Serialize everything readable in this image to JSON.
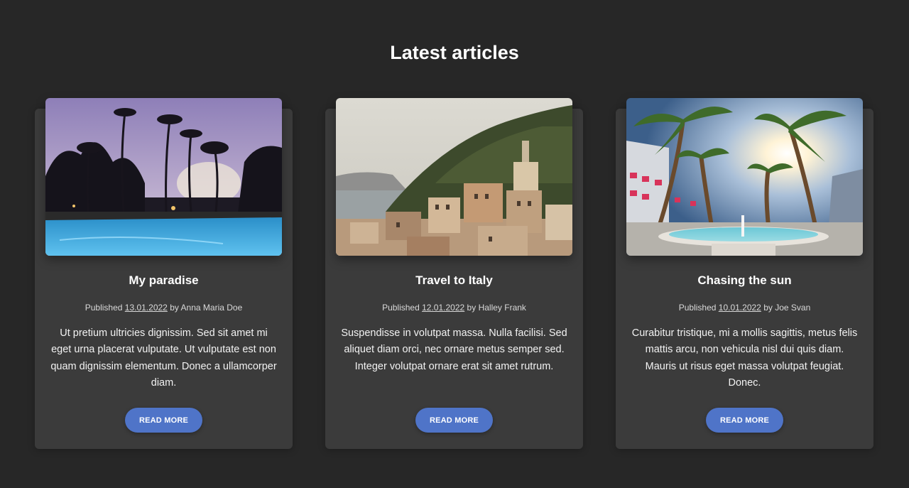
{
  "section": {
    "title": "Latest articles"
  },
  "articles": [
    {
      "title": "My paradise",
      "published_label": "Published",
      "date": "13.01.2022",
      "by_label": "by",
      "author": "Anna Maria Doe",
      "text": "Ut pretium ultricies dignissim. Sed sit amet mi eget urna placerat vulputate. Ut vulputate est non quam dignissim elementum. Donec a ullamcorper diam.",
      "button_label": "READ MORE",
      "image_alt": "tropical-pool-image"
    },
    {
      "title": "Travel to Italy",
      "published_label": "Published",
      "date": "12.01.2022",
      "by_label": "by",
      "author": "Halley Frank",
      "text": "Suspendisse in volutpat massa. Nulla facilisi. Sed aliquet diam orci, nec ornare metus semper sed. Integer volutpat ornare erat sit amet rutrum.",
      "button_label": "READ MORE",
      "image_alt": "italian-coastal-village-image"
    },
    {
      "title": "Chasing the sun",
      "published_label": "Published",
      "date": "10.01.2022",
      "by_label": "by",
      "author": "Joe Svan",
      "text": "Curabitur tristique, mi a mollis sagittis, metus felis mattis arcu, non vehicula nisl dui quis diam. Mauris ut risus eget massa volutpat feugiat. Donec.",
      "button_label": "READ MORE",
      "image_alt": "palm-trees-sun-image"
    }
  ],
  "colors": {
    "background": "#272727",
    "card": "#3b3b3b",
    "button": "#4f74c8"
  }
}
